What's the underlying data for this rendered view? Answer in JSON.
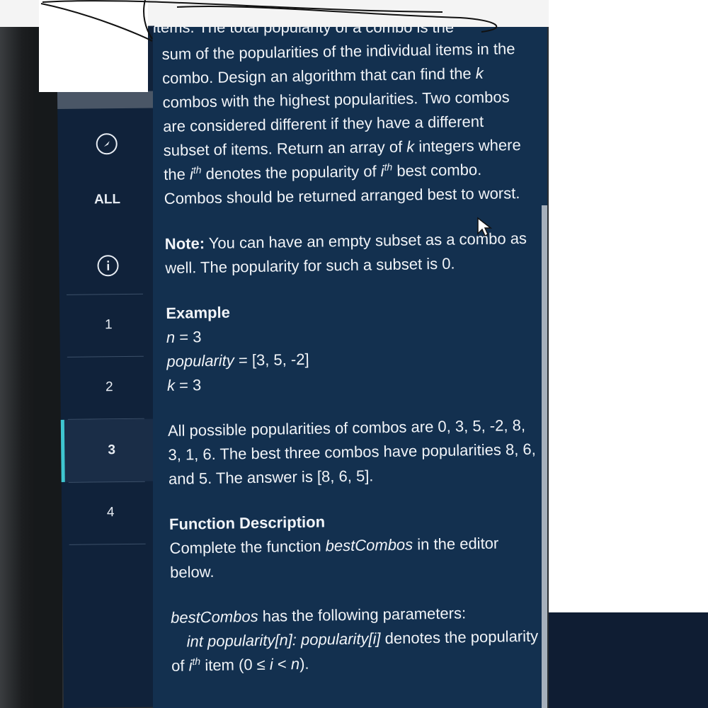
{
  "sidebar": {
    "items": [
      {
        "id": "compass",
        "label": "",
        "icon": "compass-icon"
      },
      {
        "id": "all",
        "label": "ALL"
      },
      {
        "id": "info",
        "label": "",
        "icon": "info-icon"
      },
      {
        "id": "q1",
        "label": "1"
      },
      {
        "id": "q2",
        "label": "2"
      },
      {
        "id": "q3",
        "label": "3",
        "active": true
      },
      {
        "id": "q4",
        "label": "4"
      }
    ],
    "accent_color": "#3fc6d0"
  },
  "problem": {
    "cut_top_line": "items. The total popularity of a combo is the",
    "para1_a": "sum of the popularities of the individual items in the combo. Design an algorithm that can find the ",
    "para1_k": "k",
    "para1_b": " combos with the highest popularities. Two combos are considered different if they have a different subset of items. Return an array of ",
    "para1_k2": "k",
    "para1_c": " integers where the ",
    "para1_i": "i",
    "para1_th": "th",
    "para1_d": " denotes the popularity of ",
    "para1_i2": "i",
    "para1_th2": "th",
    "para1_e": " best combo. Combos should be returned arranged best to worst.",
    "note_label": "Note:",
    "note_text": " You can have an empty subset as a combo as well. The popularity for such a subset is 0.",
    "example_heading": "Example",
    "ex_n_var": "n",
    "ex_n_val": " = 3",
    "ex_pop_var": "popularity",
    "ex_pop_val": " = [3, 5, -2]",
    "ex_k_var": "k",
    "ex_k_val": " = 3",
    "explanation": "All possible popularities of combos are 0, 3, 5, -2, 8, 3, 1, 6. The best three combos have popularities 8, 6, and 5. The answer is [8, 6, 5].",
    "func_heading": "Function Description",
    "func_text_a": "Complete the function ",
    "func_name": "bestCombos",
    "func_text_b": " in the editor below.",
    "params_name": "bestCombos",
    "params_text": " has the following parameters:",
    "param1_sig": "int popularity[n]:",
    "param1_a": " ",
    "param1_var": "popularity[i]",
    "param1_b": " denotes the popularity of ",
    "param1_i": "i",
    "param1_th": "th",
    "param1_c": " item (0 ≤ ",
    "param1_i2": "i",
    "param1_d": " < ",
    "param1_n": "n",
    "param1_e": ")."
  },
  "colors": {
    "panel": "#13304f",
    "sidebar": "#10223a",
    "text": "#f1f4f8"
  }
}
